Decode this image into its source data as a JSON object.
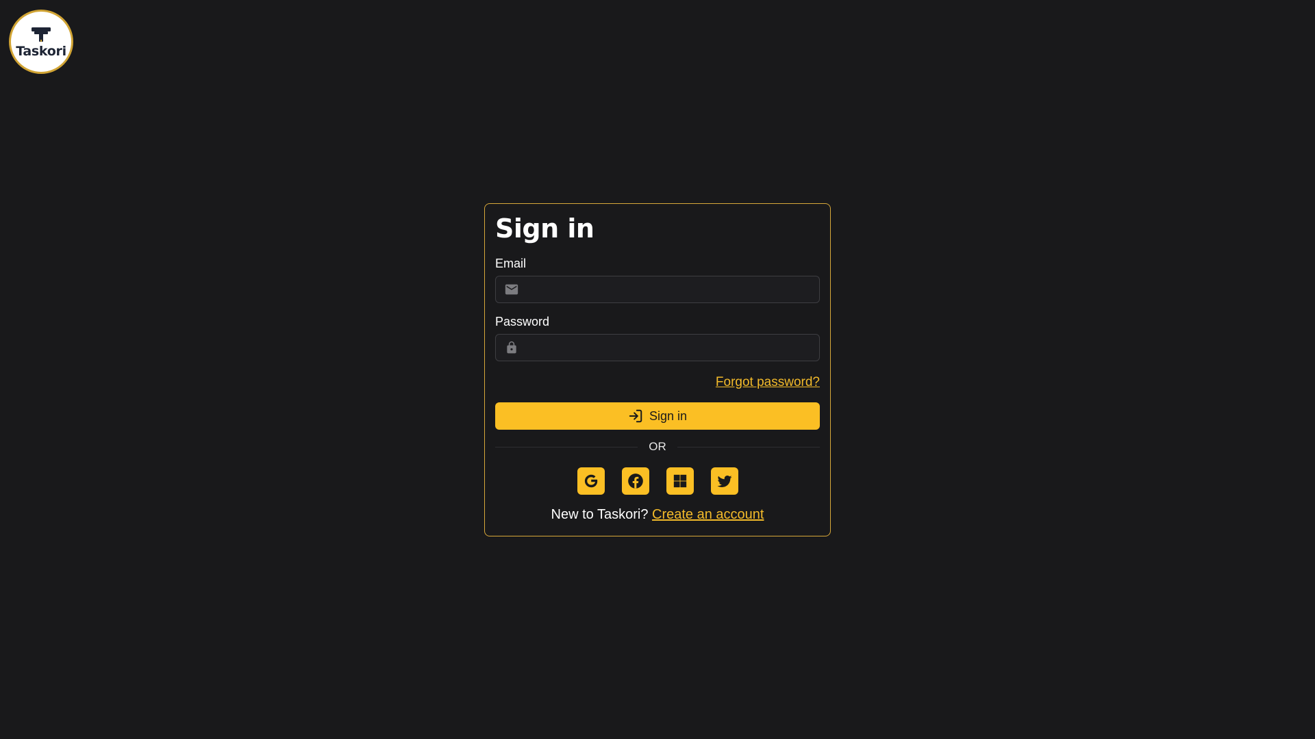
{
  "brand": {
    "name": "Taskori",
    "logo_icon": "taskori-logo-icon"
  },
  "colors": {
    "background": "#19191b",
    "accent": "#fbbf24",
    "card_border": "#d9a93a",
    "link": "#f4bb2a"
  },
  "form": {
    "title": "Sign in",
    "email": {
      "label": "Email",
      "value": "",
      "placeholder": "",
      "icon": "mail-icon"
    },
    "password": {
      "label": "Password",
      "value": "",
      "placeholder": "",
      "icon": "lock-icon"
    },
    "forgot_password": "Forgot password?",
    "submit": {
      "label": "Sign in",
      "icon": "sign-in-icon"
    },
    "divider_text": "OR",
    "social_providers": [
      {
        "name": "Google",
        "icon": "google-icon"
      },
      {
        "name": "Facebook",
        "icon": "facebook-icon"
      },
      {
        "name": "Microsoft",
        "icon": "windows-icon"
      },
      {
        "name": "Twitter",
        "icon": "twitter-icon"
      }
    ],
    "signup_prompt": "New to Taskori?",
    "signup_link": "Create an account"
  }
}
